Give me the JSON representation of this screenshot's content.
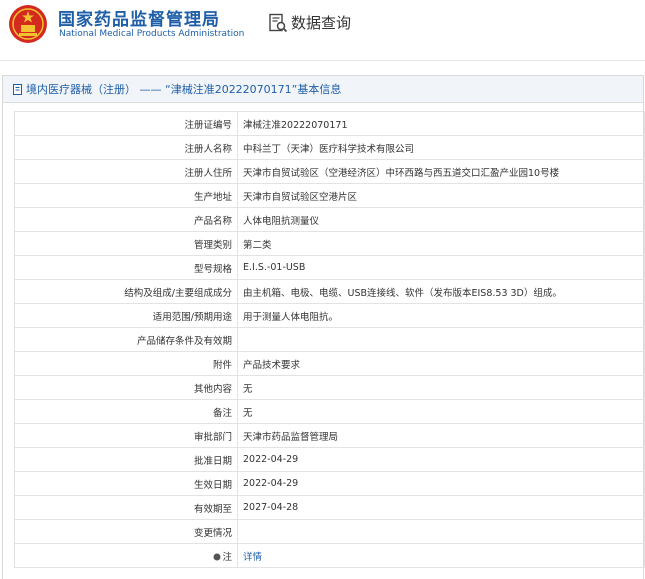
{
  "header": {
    "brand_cn": "国家药品监督管理局",
    "brand_en": "National Medical Products Administration",
    "query_label": "数据查询",
    "brand_color": "#1f5fa8",
    "emblem_color": "#d42a1e"
  },
  "panel": {
    "title": "境内医疗器械（注册） —— “津械注准20222070171”基本信息"
  },
  "rows": [
    {
      "label": "注册证编号",
      "value": "津械注准20222070171"
    },
    {
      "label": "注册人名称",
      "value": "中科兰丁（天津）医疗科学技术有限公司"
    },
    {
      "label": "注册人住所",
      "value": "天津市自贸试验区（空港经济区）中环西路与西五道交口汇盈产业园10号楼"
    },
    {
      "label": "生产地址",
      "value": "天津市自贸试验区空港片区"
    },
    {
      "label": "产品名称",
      "value": "人体电阻抗测量仪"
    },
    {
      "label": "管理类别",
      "value": "第二类"
    },
    {
      "label": "型号规格",
      "value": "E.I.S.-01-USB"
    },
    {
      "label": "结构及组成/主要组成成分",
      "value": "由主机箱、电极、电缆、USB连接线、软件（发布版本EIS8.53 3D）组成。"
    },
    {
      "label": "适用范围/预期用途",
      "value": "用于测量人体电阻抗。"
    },
    {
      "label": "产品储存条件及有效期",
      "value": ""
    },
    {
      "label": "附件",
      "value": "产品技术要求"
    },
    {
      "label": "其他内容",
      "value": "无"
    },
    {
      "label": "备注",
      "value": "无"
    },
    {
      "label": "审批部门",
      "value": "天津市药品监督管理局"
    },
    {
      "label": "批准日期",
      "value": "2022-04-29"
    },
    {
      "label": "生效日期",
      "value": "2022-04-29"
    },
    {
      "label": "有效期至",
      "value": "2027-04-28"
    },
    {
      "label": "变更情况",
      "value": ""
    },
    {
      "label": "注",
      "value": "详情",
      "icon": "info-dot-icon",
      "link": true
    }
  ]
}
